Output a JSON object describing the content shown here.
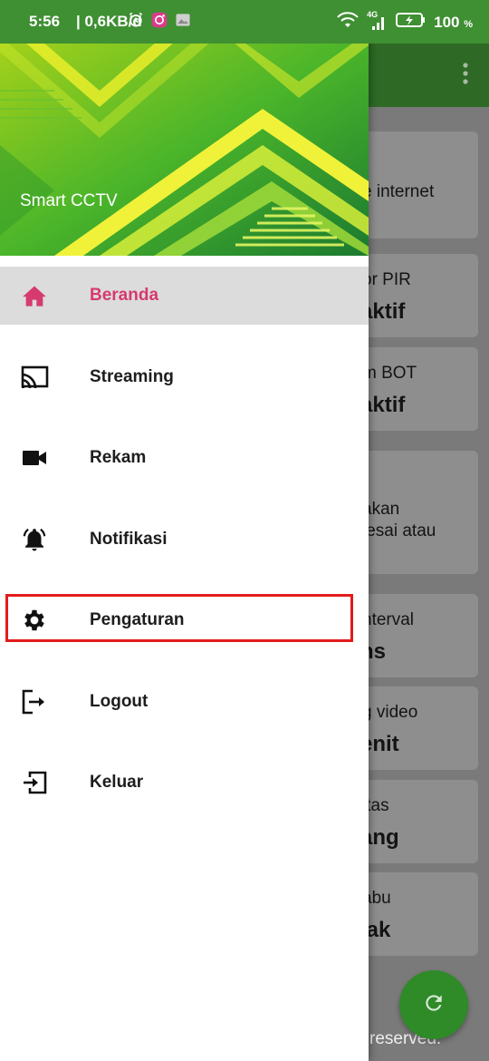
{
  "status_bar": {
    "time": "5:56",
    "net_speed": "| 0,6KB/d",
    "network_label": "4G",
    "battery_percent": "100",
    "battery_unit": "%"
  },
  "drawer": {
    "app_title": "Smart CCTV",
    "menu": [
      {
        "label": "Beranda",
        "icon": "home-icon",
        "active": true
      },
      {
        "label": "Streaming",
        "icon": "cast-icon"
      },
      {
        "label": "Rekam",
        "icon": "videocam-icon"
      },
      {
        "label": "Notifikasi",
        "icon": "alarm-bell-icon"
      },
      {
        "label": "Pengaturan",
        "icon": "gear-icon"
      },
      {
        "label": "Logout",
        "icon": "logout-icon"
      },
      {
        "label": "Keluar",
        "icon": "exit-icon"
      }
    ]
  },
  "background": {
    "cards": [
      {
        "line1": "e internet"
      },
      {
        "line1": "or PIR",
        "big": "aktif"
      },
      {
        "line1": "m BOT",
        "big": "aktif"
      },
      {
        "line1": "akan",
        "line2": "lesai atau"
      },
      {
        "line1": "nterval",
        "big": "ns"
      },
      {
        "line1": "g video",
        "big": "enit"
      },
      {
        "line1": "itas",
        "big": "ang"
      },
      {
        "line1": "abu",
        "big": "lak"
      }
    ],
    "footer": "reserved."
  },
  "colors": {
    "primary": "#3f8f33",
    "accent": "#d63a6f",
    "highlight": "#e31b1b"
  }
}
